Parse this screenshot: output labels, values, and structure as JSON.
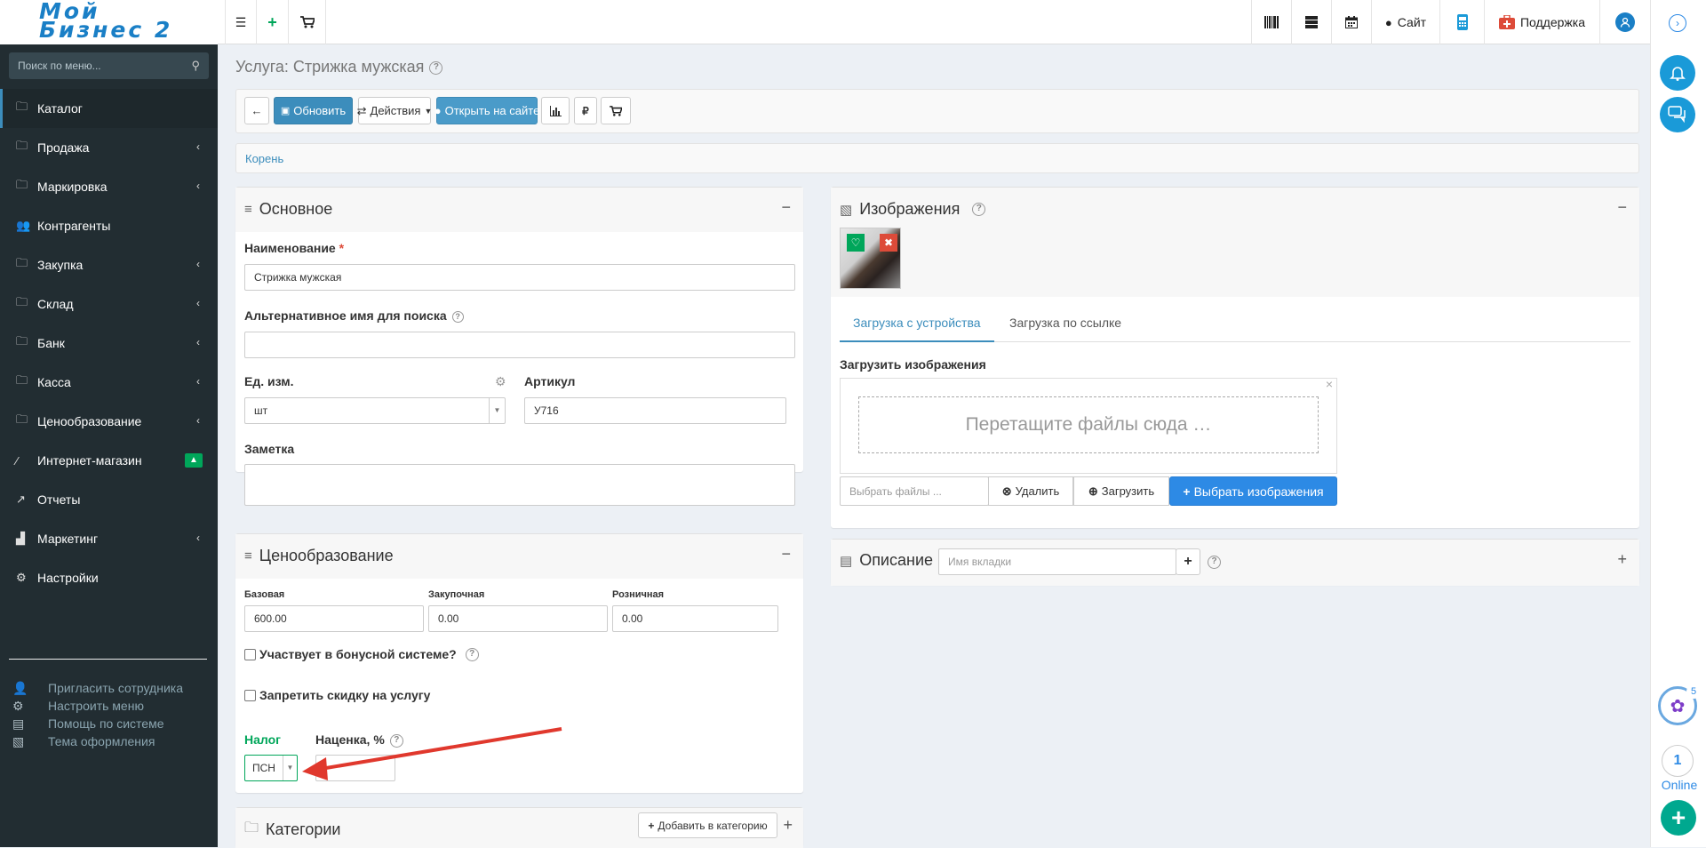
{
  "logo": {
    "line1": "Мой",
    "line2": "Бизнес 2"
  },
  "topbar": {
    "site_label": "Сайт",
    "support_label": "Поддержка"
  },
  "sidebar": {
    "search_placeholder": "Поиск по меню...",
    "items": [
      {
        "label": "Каталог",
        "icon": "folder-icon",
        "chevron": false
      },
      {
        "label": "Продажа",
        "icon": "folder-icon",
        "chevron": true
      },
      {
        "label": "Маркировка",
        "icon": "folder-icon",
        "chevron": true
      },
      {
        "label": "Контрагенты",
        "icon": "users-icon",
        "chevron": false
      },
      {
        "label": "Закупка",
        "icon": "folder-icon",
        "chevron": true
      },
      {
        "label": "Склад",
        "icon": "folder-icon",
        "chevron": true
      },
      {
        "label": "Банк",
        "icon": "folder-icon",
        "chevron": true
      },
      {
        "label": "Касса",
        "icon": "folder-icon",
        "chevron": true
      },
      {
        "label": "Ценообразование",
        "icon": "folder-icon",
        "chevron": true
      },
      {
        "label": "Интернет-магазин",
        "icon": "wand-icon",
        "chevron": false
      },
      {
        "label": "Отчеты",
        "icon": "line-chart-icon",
        "chevron": false
      },
      {
        "label": "Маркетинг",
        "icon": "bar-chart-icon",
        "chevron": true
      },
      {
        "label": "Настройки",
        "icon": "gear-icon",
        "chevron": false
      }
    ],
    "extra": [
      {
        "label": "Пригласить сотрудника",
        "icon": "user-plus-icon"
      },
      {
        "label": "Настроить меню",
        "icon": "cogs-icon"
      },
      {
        "label": "Помощь по системе",
        "icon": "book-icon"
      },
      {
        "label": "Тема оформления",
        "icon": "image-icon"
      }
    ]
  },
  "page": {
    "title": "Услуга: Стрижка мужская",
    "toolbar": {
      "update": "Обновить",
      "actions": "Действия",
      "open_site": "Открыть на сайте"
    },
    "breadcrumb": "Корень"
  },
  "main_box": {
    "title": "Основное",
    "name_label": "Наименование",
    "name_value": "Стрижка мужская",
    "alt_name_label": "Альтернативное имя для поиска",
    "unit_label": "Ед. изм.",
    "unit_value": "шт",
    "article_label": "Артикул",
    "article_value": "У716",
    "note_label": "Заметка"
  },
  "pricing_box": {
    "title": "Ценообразование",
    "base_label": "Базовая",
    "base_value": "600.00",
    "purchase_label": "Закупочная",
    "purchase_value": "0.00",
    "retail_label": "Розничная",
    "retail_value": "0.00",
    "bonus_label": "Участвует в бонусной системе?",
    "nodiscount_label": "Запретить скидку на услугу",
    "tax_label": "Налог",
    "tax_value": "ПСН",
    "markup_label": "Наценка, %"
  },
  "categories_box": {
    "title": "Категории",
    "add_button": "Добавить в категорию"
  },
  "images_box": {
    "title": "Изображения",
    "tab_device": "Загрузка с устройства",
    "tab_link": "Загрузка по ссылке",
    "upload_label": "Загрузить изображения",
    "dropzone_text": "Перетащите файлы сюда …",
    "file_placeholder": "Выбрать файлы ...",
    "delete_button": "Удалить",
    "upload_button": "Загрузить",
    "choose_button": "Выбрать изображения"
  },
  "description_box": {
    "title": "Описание",
    "tab_name_placeholder": "Имя вкладки"
  },
  "right_strip": {
    "badge_count": "5",
    "online_count": "1",
    "online_label": "Online"
  },
  "colors": {
    "sidebar_bg": "#222d32",
    "primary": "#3c8dbc",
    "success": "#00a65a",
    "danger": "#dd4b39",
    "annotation_arrow": "#e0382d"
  }
}
